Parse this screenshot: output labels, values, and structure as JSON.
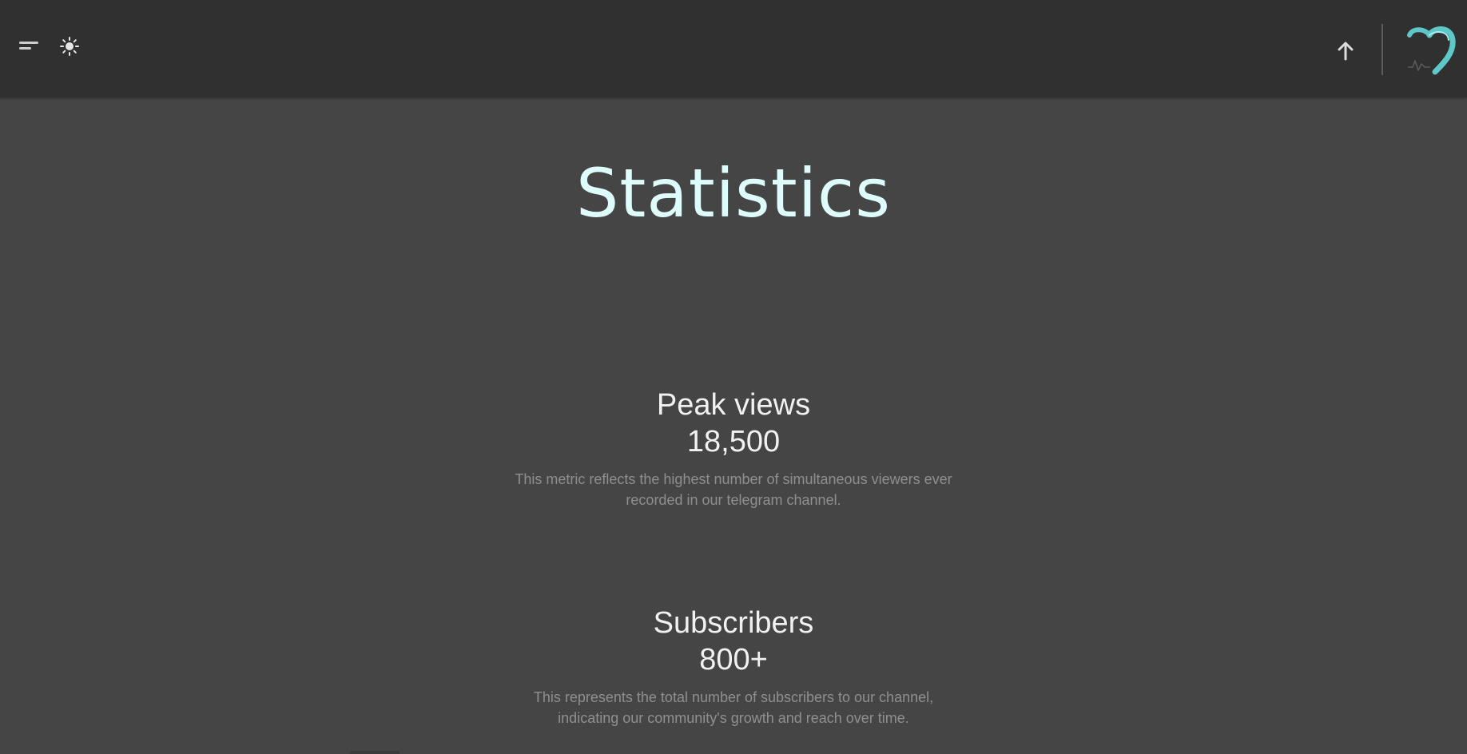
{
  "header": {
    "menu_icon": "menu-lines-icon",
    "theme_icon": "sun-icon",
    "scroll_top_icon": "arrow-up-icon",
    "logo_icon": "heart-logo-icon"
  },
  "page": {
    "title": "Statistics"
  },
  "stats": [
    {
      "label": "Peak views",
      "value": "18,500",
      "description": "This metric reflects the highest number of simultaneous viewers ever recorded in our telegram channel."
    },
    {
      "label": "Subscribers",
      "value": "800+",
      "description": "This represents the total number of subscribers to our channel, indicating our community's growth and reach over time."
    }
  ],
  "colors": {
    "background": "#454545",
    "header": "#303030",
    "title": "#dffcfc",
    "accent": "#5ec8c8",
    "text": "#f1f1f1",
    "muted": "#8f8f8f"
  }
}
